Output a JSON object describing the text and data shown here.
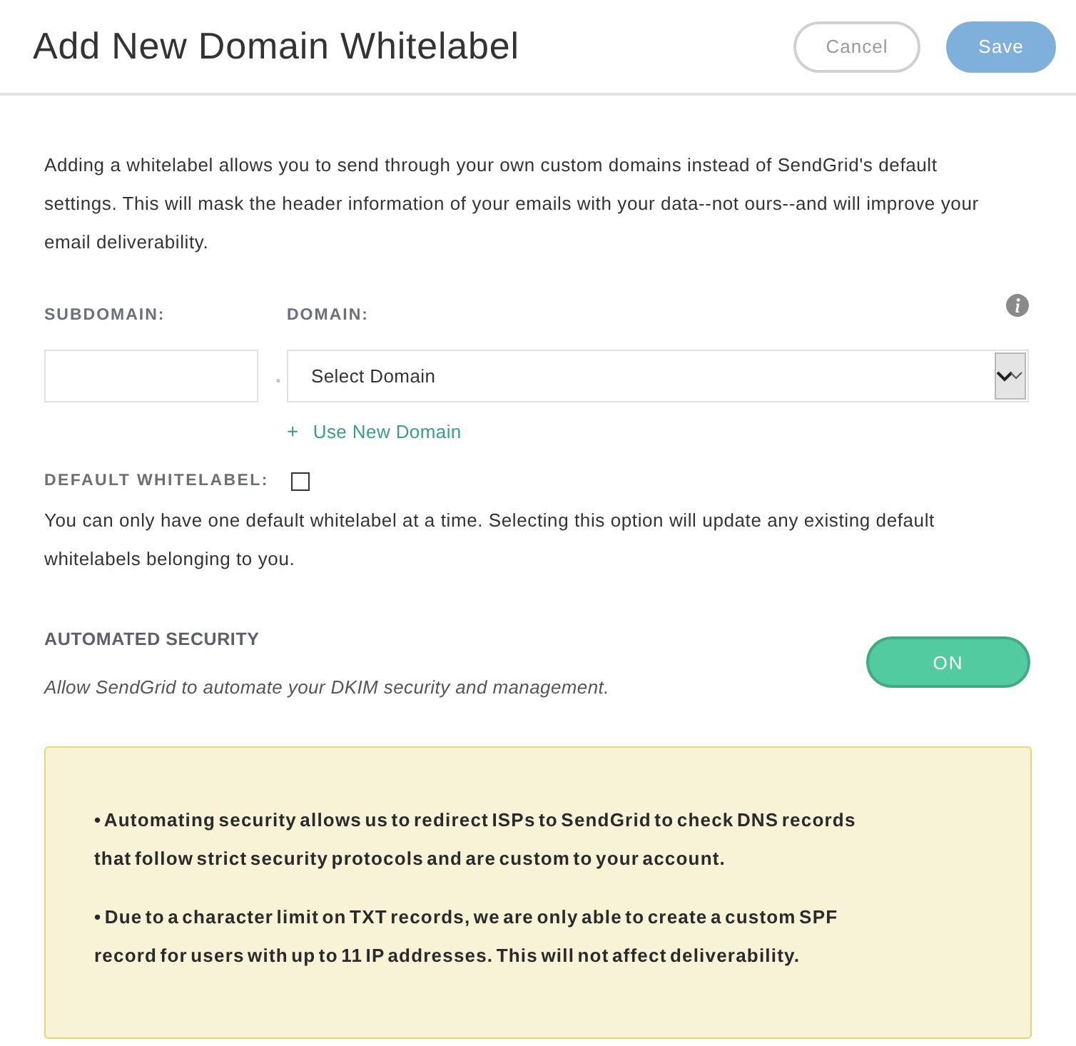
{
  "header": {
    "title": "Add New Domain Whitelabel",
    "buttons": [
      {
        "label": "Cancel",
        "kind": "secondary"
      },
      {
        "label": "Save",
        "kind": "primary"
      }
    ]
  },
  "intro": "Adding a whitelabel allows you to send through your own custom domains instead of SendGrid's default settings. This will mask the header information of your emails with your data--not ours--and will improve your email deliverability.",
  "subdomain": {
    "label": "SUBDOMAIN:"
  },
  "separator": ".",
  "domain": {
    "label": "DOMAIN:",
    "value": "Select Domain",
    "add_link": {
      "symbol": "+",
      "label": "Use New Domain"
    }
  },
  "default_whitelabel": {
    "label": "DEFAULT WHITELABEL:",
    "checked": false,
    "note": "You can only have one default whitelabel at a time. Selecting this option will update any existing default whitelabels belonging to you."
  },
  "automated_security": {
    "title": "AUTOMATED SECURITY",
    "description": "Allow SendGrid to automate your DKIM security and management.",
    "on": true,
    "toggle_label": "ON"
  },
  "notice": {
    "items": [
      "• Automating security allows us to redirect ISPs to SendGrid to check DNS records that follow strict security protocols and are custom to your account.",
      "• Due to a character limit on TXT records, we are only able to create a custom SPF record for users with up to 11 IP addresses. This will not affect deliverability."
    ]
  }
}
